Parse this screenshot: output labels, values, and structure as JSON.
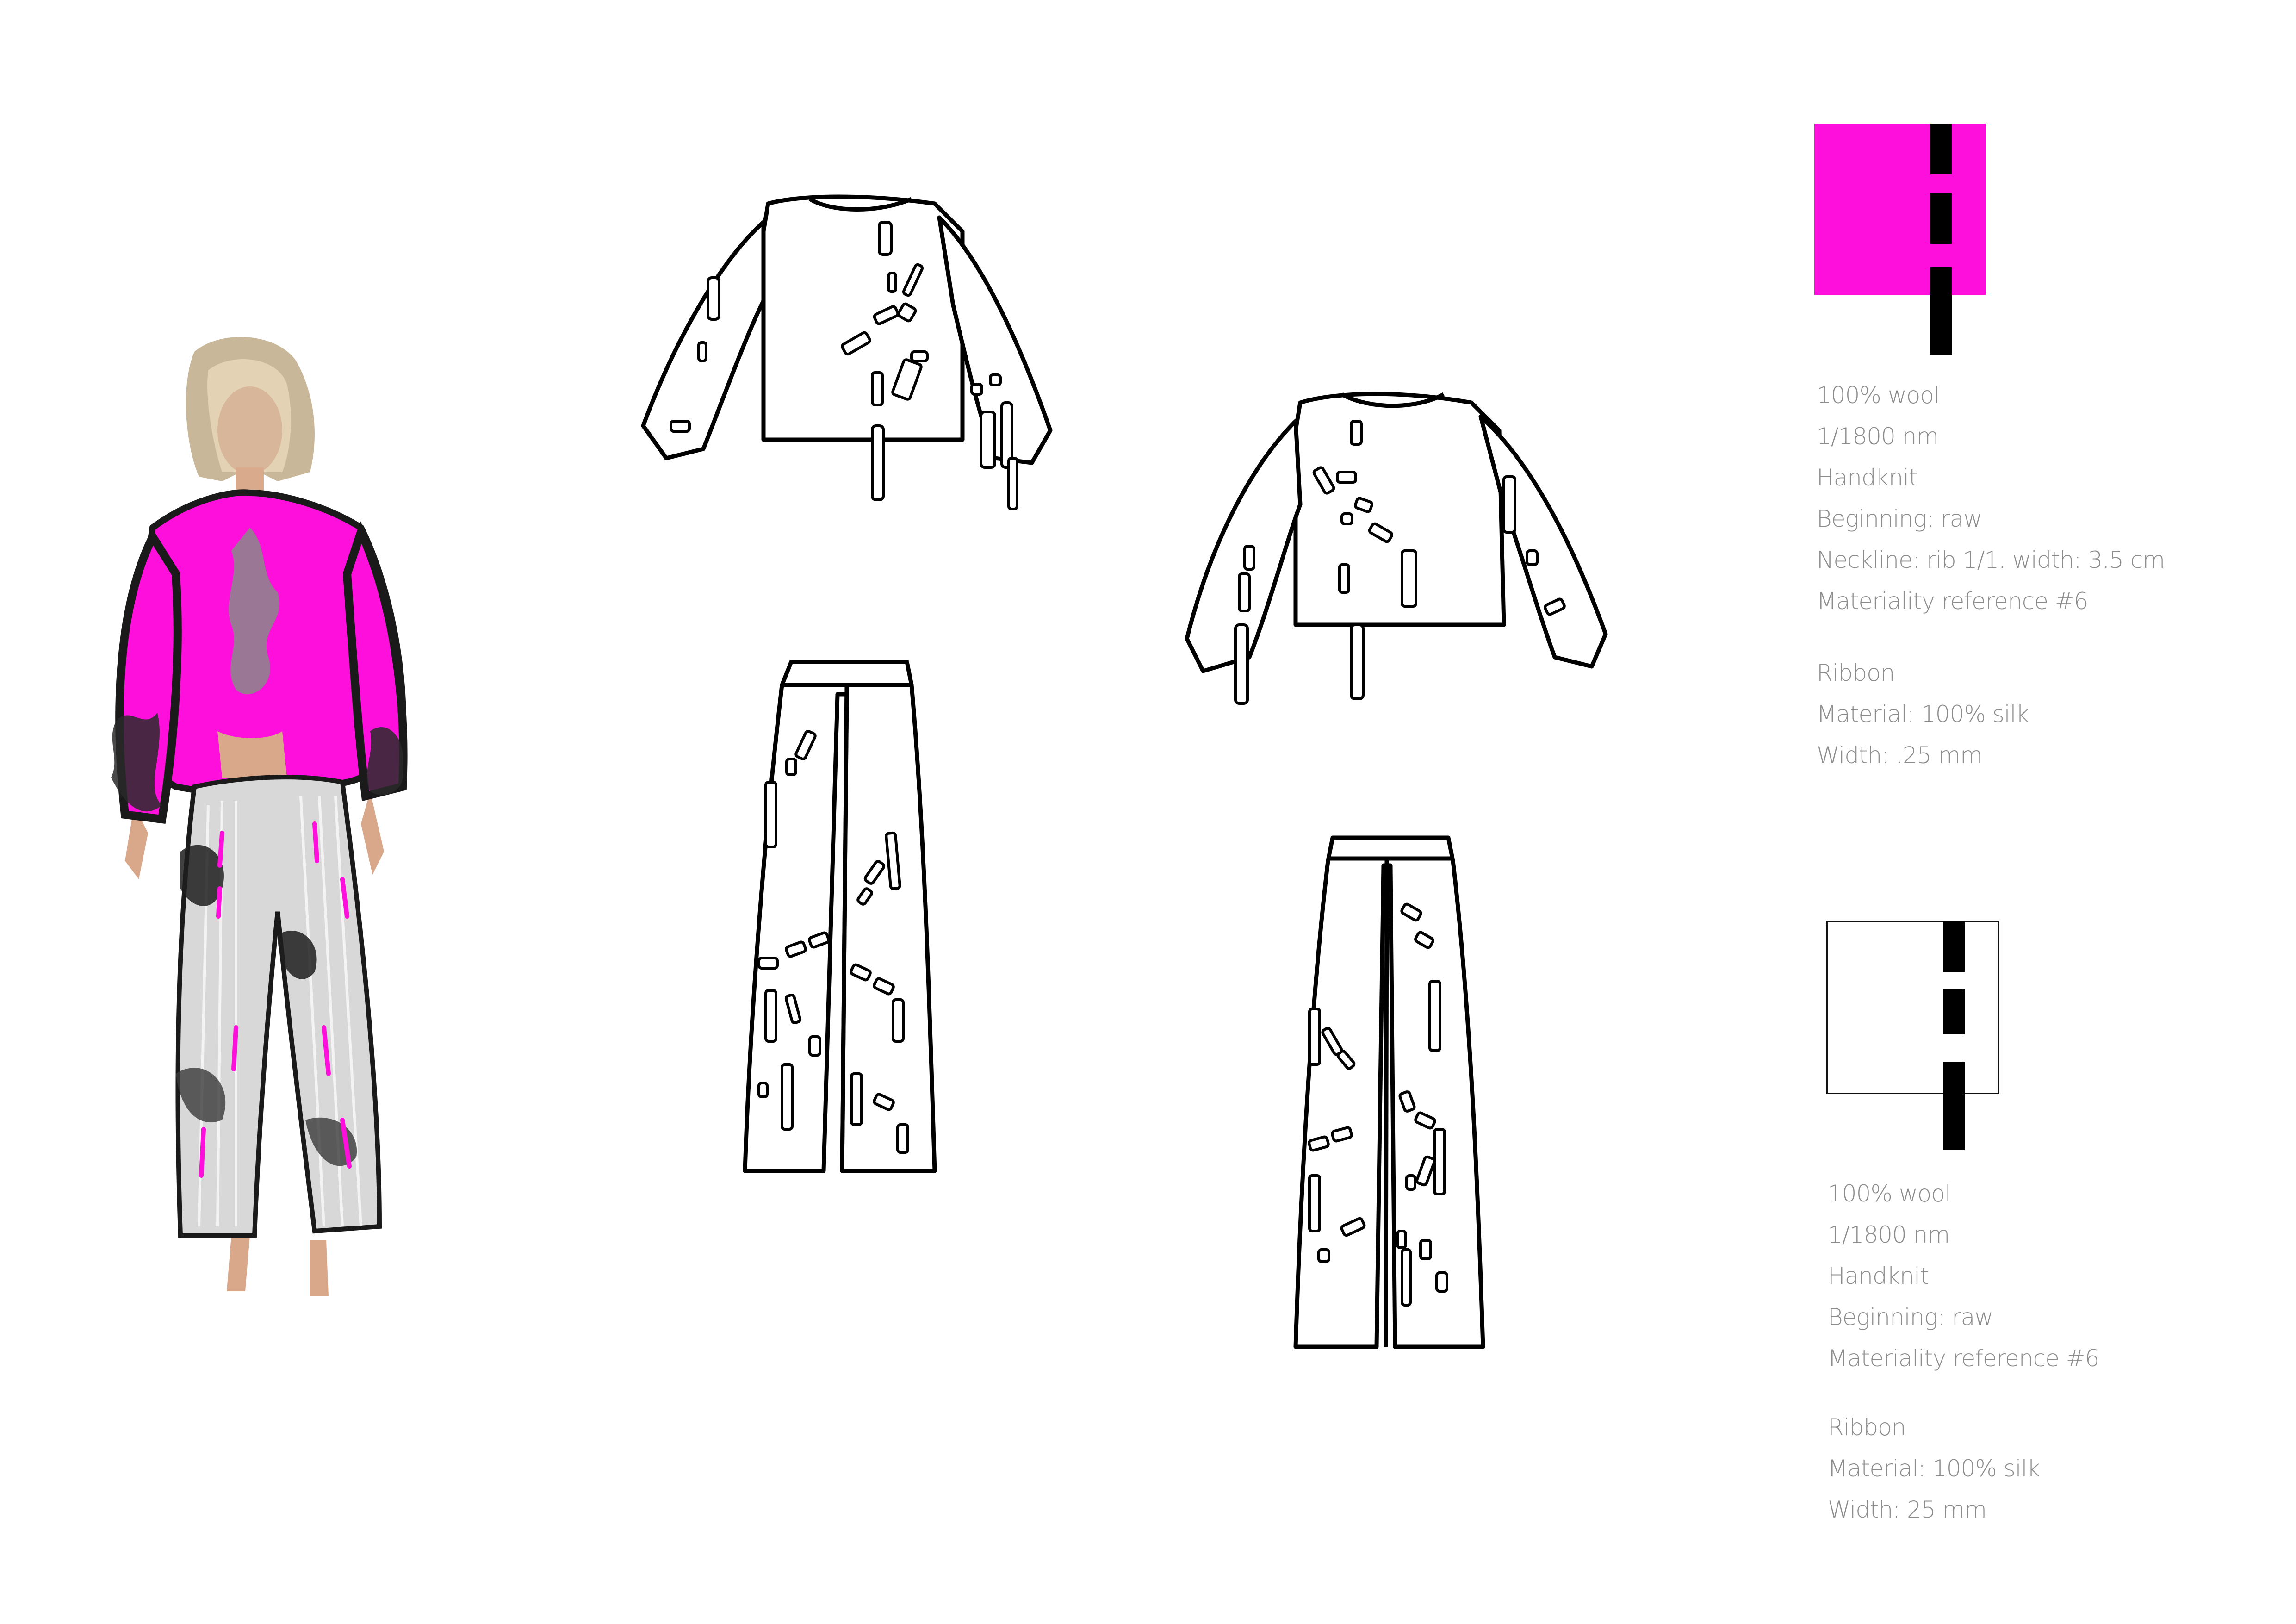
{
  "colors": {
    "swatch_primary": "#ff0fdb",
    "swatch_secondary": "#ffffff",
    "ribbon": "#000000",
    "outline": "#000000",
    "spec_text": "#8c8c8c"
  },
  "illustration": {
    "figure": "fashion-illustration",
    "flats": [
      "top-front-flat",
      "trousers-front-flat",
      "top-back-flat",
      "trousers-back-flat"
    ]
  },
  "spec_primary": {
    "lines": [
      "100% wool",
      "1/1800 nm",
      "Handknit",
      "Beginning: raw",
      "Neckline: rib 1/1. width: 3.5 cm",
      "Materiality reference #6"
    ],
    "ribbon_lines": [
      "Ribbon",
      "Material: 100% silk",
      "Width: .25 mm"
    ]
  },
  "spec_secondary": {
    "lines": [
      "100% wool",
      "1/1800 nm",
      "Handknit",
      "Beginning: raw",
      "Materiality reference #6"
    ],
    "ribbon_lines": [
      "Ribbon",
      "Material: 100% silk",
      "Width: 25 mm"
    ]
  }
}
